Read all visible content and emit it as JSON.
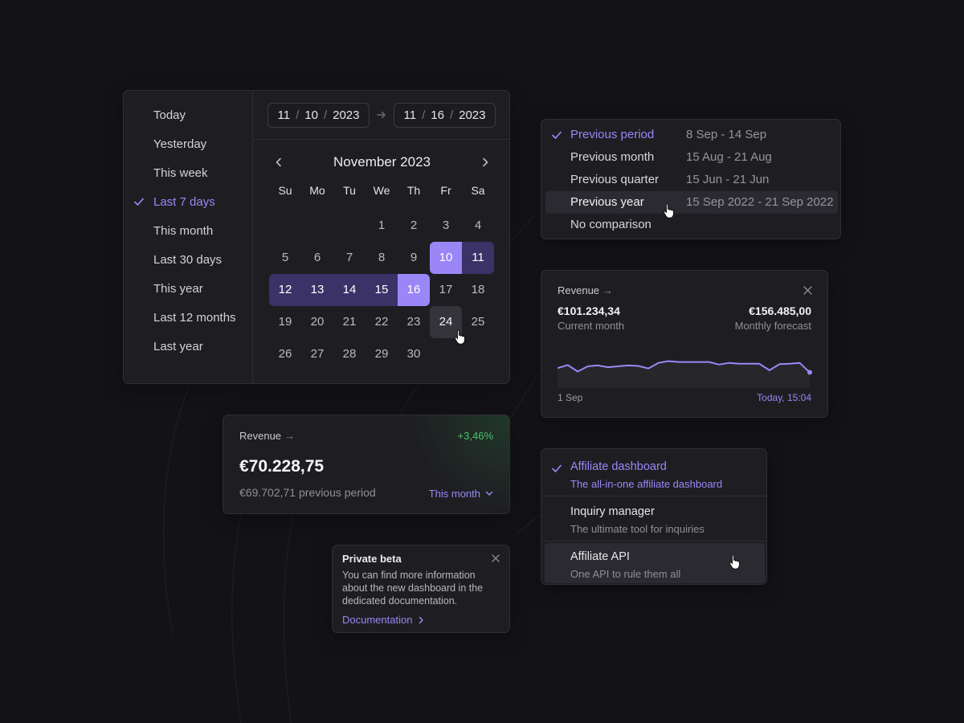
{
  "colors": {
    "background": "#131316",
    "card": "#1e1e22",
    "accent": "#9b86f7",
    "range": "#3b3268",
    "positive": "#4bc36b"
  },
  "date_picker": {
    "presets": [
      {
        "label": "Today",
        "selected": false
      },
      {
        "label": "Yesterday",
        "selected": false
      },
      {
        "label": "This week",
        "selected": false
      },
      {
        "label": "Last 7 days",
        "selected": true
      },
      {
        "label": "This month",
        "selected": false
      },
      {
        "label": "Last 30 days",
        "selected": false
      },
      {
        "label": "This year",
        "selected": false
      },
      {
        "label": "Last 12 months",
        "selected": false
      },
      {
        "label": "Last year",
        "selected": false
      }
    ],
    "start": {
      "month": "11",
      "day": "10",
      "year": "2023"
    },
    "end": {
      "month": "11",
      "day": "16",
      "year": "2023"
    },
    "separator": "/",
    "month_title": "November 2023",
    "weekdays": [
      "Su",
      "Mo",
      "Tu",
      "We",
      "Th",
      "Fr",
      "Sa"
    ],
    "first_weekday_index": 3,
    "days_in_month": 30,
    "range_start": 10,
    "range_end": 16,
    "hovered_day": 24
  },
  "comparison": {
    "options": [
      {
        "label": "Previous period",
        "range": "8 Sep - 14 Sep",
        "selected": true
      },
      {
        "label": "Previous month",
        "range": "15 Aug - 21 Aug",
        "selected": false
      },
      {
        "label": "Previous quarter",
        "range": "15 Jun - 21 Jun",
        "selected": false
      },
      {
        "label": "Previous year",
        "range": "15 Sep 2022 - 21 Sep 2022",
        "selected": false,
        "hovered": true
      },
      {
        "label": "No comparison",
        "range": "",
        "selected": false
      }
    ]
  },
  "revenue_chart": {
    "title": "Revenue",
    "current_value": "€101.234,34",
    "current_label": "Current month",
    "forecast_value": "€156.485,00",
    "forecast_label": "Monthly forecast",
    "x_start": "1 Sep",
    "x_end": "Today, 15:04"
  },
  "chart_data": {
    "type": "line",
    "x": [
      1,
      2,
      3,
      4,
      5,
      6,
      7,
      8,
      9,
      10,
      11,
      12,
      13,
      14,
      15,
      16,
      17,
      18,
      19,
      20,
      21,
      22,
      23,
      24,
      25,
      26
    ],
    "values": [
      46,
      53,
      38,
      50,
      52,
      48,
      50,
      52,
      51,
      45,
      58,
      62,
      60,
      60,
      60,
      60,
      54,
      58,
      56,
      56,
      56,
      41,
      55,
      56,
      58,
      36
    ],
    "ylim": [
      0,
      100
    ],
    "grid": false
  },
  "revenue_summary": {
    "title": "Revenue",
    "change": "+3,46%",
    "amount": "€70.228,75",
    "previous": "€69.702,71 previous period",
    "period_label": "This month"
  },
  "private_beta": {
    "title": "Private beta",
    "body": "You can find more information about the new dashboard in the dedicated documentation.",
    "link_label": "Documentation"
  },
  "products": {
    "items": [
      {
        "name": "Affiliate dashboard",
        "description": "The all-in-one affiliate dashboard",
        "selected": true
      },
      {
        "name": "Inquiry manager",
        "description": "The ultimate tool for inquiries",
        "selected": false
      },
      {
        "name": "Affiliate API",
        "description": "One API to rule them all",
        "selected": false,
        "hovered": true
      }
    ]
  }
}
